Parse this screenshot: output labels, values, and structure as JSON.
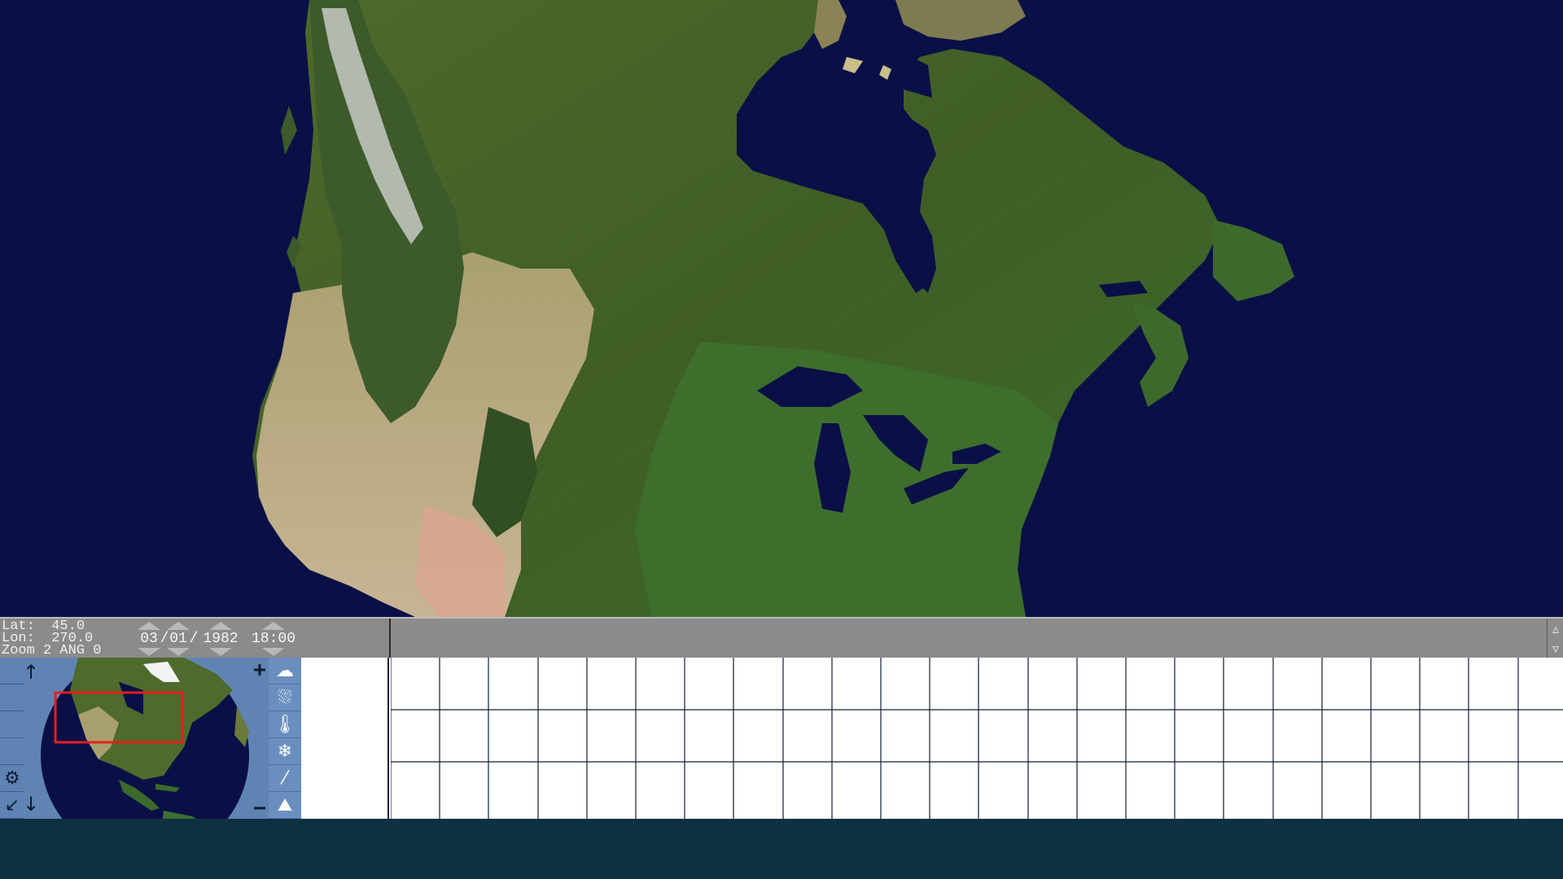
{
  "readout": {
    "lat_line": "Lat:  45.0",
    "lon_line": "Lon:  270.0",
    "zoom_line": "Zoom 2 ANG 0"
  },
  "time_controls": {
    "month": "03",
    "day": "01",
    "year": "1982",
    "separator": "/",
    "time": "18:00"
  },
  "scroll": {
    "up_icon": "▵",
    "down_icon": "▿"
  },
  "navigation": {
    "pan_up_icon": "↑",
    "pan_down_icon": "↓",
    "zoom_in": "+",
    "zoom_out": "−"
  },
  "left_tools": {
    "settings_icon": "⚙",
    "pointer_icon": "↙"
  },
  "layer_tools": [
    {
      "icon": "cloud-icon",
      "glyph": "☁"
    },
    {
      "icon": "rain-cloud-icon",
      "glyph": "⛆"
    },
    {
      "icon": "thermometer-icon",
      "glyph": "🌡"
    },
    {
      "icon": "snow-icon",
      "glyph": "❄"
    },
    {
      "icon": "wind-icon",
      "glyph": "⁄"
    },
    {
      "icon": "terrain-icon",
      "glyph": "⛰"
    }
  ],
  "grid": {
    "rows": 3,
    "columns": 23
  },
  "colors": {
    "ocean": "#0a1046",
    "panel_blue": "#5f84b3",
    "info_bar": "#8b8b8b",
    "selection": "#e02020",
    "grid_line": "#121d36"
  }
}
